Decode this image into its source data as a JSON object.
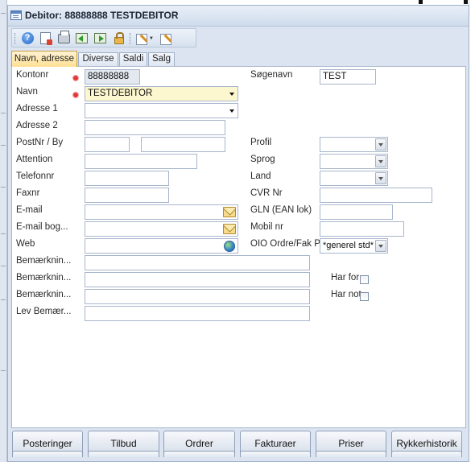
{
  "window": {
    "title": "Debitor: 88888888 TESTDEBITOR"
  },
  "toolbar": {
    "icons": [
      "help-icon",
      "delete-doc-icon",
      "print-icon",
      "previous-record-icon",
      "next-record-icon",
      "lock-icon",
      "edit-dropdown-icon",
      "edit-icon"
    ]
  },
  "tabs": [
    {
      "label": "Navn, adresse",
      "active": true
    },
    {
      "label": "Diverse",
      "active": false
    },
    {
      "label": "Saldi",
      "active": false
    },
    {
      "label": "Salg",
      "active": false
    }
  ],
  "form": {
    "kontonr": {
      "label": "Kontonr",
      "value": "88888888"
    },
    "navn": {
      "label": "Navn",
      "value": "TESTDEBITOR"
    },
    "adresse1": {
      "label": "Adresse 1",
      "value": ""
    },
    "adresse2": {
      "label": "Adresse 2",
      "value": ""
    },
    "postnr_by": {
      "label": "PostNr / By",
      "postnr": "",
      "by": ""
    },
    "attention": {
      "label": "Attention",
      "value": ""
    },
    "telefonnr": {
      "label": "Telefonnr",
      "value": ""
    },
    "faxnr": {
      "label": "Faxnr",
      "value": ""
    },
    "email": {
      "label": "E-mail",
      "value": ""
    },
    "email_bog": {
      "label": "E-mail bog...",
      "value": ""
    },
    "web": {
      "label": "Web",
      "value": ""
    },
    "bemaerkning1": {
      "label": "Bemærknin...",
      "value": ""
    },
    "bemaerkning2": {
      "label": "Bemærknin...",
      "value": ""
    },
    "bemaerkning3": {
      "label": "Bemærknin...",
      "value": ""
    },
    "lev_bemaerkning": {
      "label": "Lev Bemær...",
      "value": ""
    },
    "soegenavn": {
      "label": "Søgenavn",
      "value": "TEST"
    },
    "profil": {
      "label": "Profil",
      "value": ""
    },
    "sprog": {
      "label": "Sprog",
      "value": ""
    },
    "land": {
      "label": "Land",
      "value": ""
    },
    "cvr_nr": {
      "label": "CVR Nr",
      "value": ""
    },
    "gln": {
      "label": "GLN (EAN lok)",
      "value": ""
    },
    "mobil_nr": {
      "label": "Mobil nr",
      "value": ""
    },
    "oio": {
      "label": "OIO Ordre/Fak P",
      "value": "*generel std*"
    },
    "har_for": {
      "label": "Har for",
      "checked": false
    },
    "har_not": {
      "label": "Har not",
      "checked": false
    }
  },
  "buttons": {
    "posteringer": "Posteringer",
    "tilbud": "Tilbud",
    "ordrer": "Ordrer",
    "fakturaer": "Fakturaer",
    "priser": "Priser",
    "rykkerhistorik": "Rykkerhistorik"
  },
  "colors": {
    "required_field": "#fdf7cf",
    "required_marker": "#e23a3a",
    "active_tab": "#ffdf94",
    "window_bg": "#dbe4f0"
  }
}
